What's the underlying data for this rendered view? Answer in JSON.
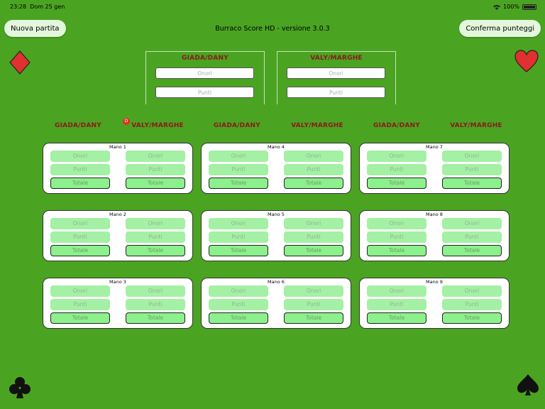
{
  "status": {
    "time": "23:28",
    "date": "Dom 25 gen",
    "battery": "100%"
  },
  "buttons": {
    "new_game": "Nuova partita",
    "confirm_scores": "Conferma punteggi"
  },
  "app_title": "Burraco Score HD - versione 3.0.3",
  "teams": {
    "a": "GIADA/DANY",
    "b": "VALY/MARGHE"
  },
  "fields": {
    "onori": "Onori",
    "punti": "Punti",
    "totale": "Totale"
  },
  "dealer_badge": "D",
  "hands": [
    {
      "label": "Mano 1"
    },
    {
      "label": "Mano 2"
    },
    {
      "label": "Mano 3"
    },
    {
      "label": "Mano 4"
    },
    {
      "label": "Mano 5"
    },
    {
      "label": "Mano 6"
    },
    {
      "label": "Mano 7"
    },
    {
      "label": "Mano 8"
    },
    {
      "label": "Mano 9"
    }
  ],
  "colors": {
    "background": "#4aa422",
    "team_text": "#8b1a1a",
    "cell": "#a4f0a4",
    "suit_red": "#e03030",
    "suit_black": "#111111"
  },
  "icons": [
    "diamond-suit-icon",
    "heart-suit-icon",
    "club-suit-icon",
    "spade-suit-icon"
  ]
}
